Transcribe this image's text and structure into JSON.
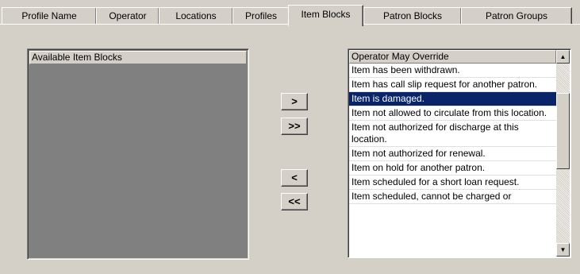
{
  "tabs": [
    {
      "label": "Profile Name"
    },
    {
      "label": "Operator"
    },
    {
      "label": "Locations"
    },
    {
      "label": "Profiles"
    },
    {
      "label": "Item Blocks"
    },
    {
      "label": "Patron Blocks"
    },
    {
      "label": "Patron Groups"
    }
  ],
  "available": {
    "header": "Available Item Blocks"
  },
  "buttons": {
    "add": ">",
    "add_all": ">>",
    "remove": "<",
    "remove_all": "<<"
  },
  "override": {
    "header": "Operator May Override",
    "items": [
      {
        "label": "Item has been withdrawn."
      },
      {
        "label": "Item has call slip request for another patron."
      },
      {
        "label": "Item is damaged."
      },
      {
        "label": "Item not allowed to circulate from this location."
      },
      {
        "label": "Item not authorized for discharge at this location."
      },
      {
        "label": "Item not authorized for renewal."
      },
      {
        "label": "Item on hold for another patron."
      },
      {
        "label": "Item scheduled for a short loan request."
      },
      {
        "label": "Item scheduled, cannot be charged or"
      }
    ],
    "selected_item": "Item is damaged."
  },
  "colors": {
    "selection": "#0a246a",
    "face": "#d4d0c8",
    "empty_list": "#808080"
  },
  "icons": {
    "scroll_up": "triangle-up-icon",
    "scroll_down": "triangle-down-icon"
  }
}
